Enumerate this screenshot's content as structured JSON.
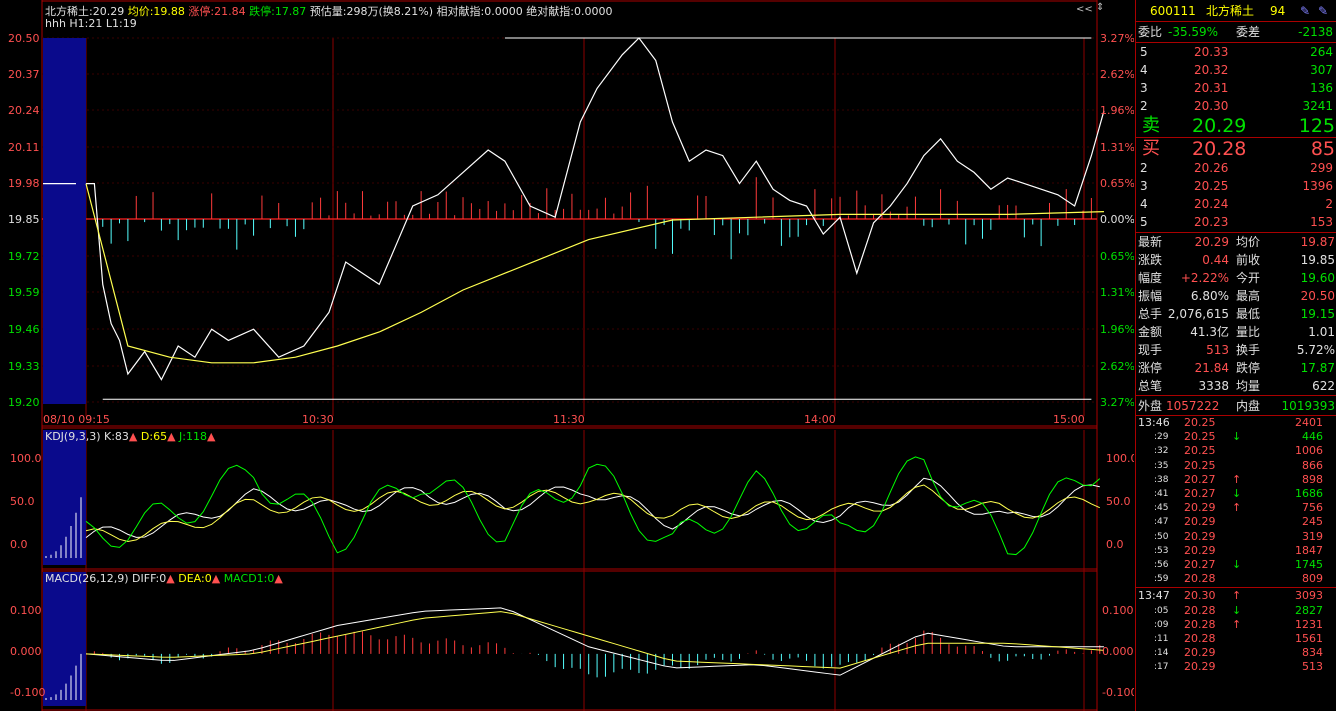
{
  "header": {
    "name": "北方稀土:20.29",
    "avg": "均价:19.88",
    "limit_up": "涨停:21.84",
    "limit_down": "跌停:17.87",
    "forecast": "预估量:298万(换8.21%)",
    "rel_contrib": "相对献指:0.0000",
    "abs_contrib": "绝对献指:0.0000",
    "line2": "hhh  H1:21  L1:19",
    "btn_close": "<<",
    "btn_pin": "⇕"
  },
  "price_axis": {
    "left": [
      "20.50",
      "20.37",
      "20.24",
      "20.11",
      "19.98",
      "19.85",
      "19.72",
      "19.59",
      "19.46",
      "19.33",
      "19.20"
    ],
    "right": [
      "3.27%",
      "2.62%",
      "1.96%",
      "1.31%",
      "0.65%",
      "0.00%",
      "0.65%",
      "1.31%",
      "1.96%",
      "2.62%",
      "3.27%"
    ]
  },
  "time_axis": [
    "08/10 09:15",
    "10:30",
    "11:30",
    "14:00",
    "15:00"
  ],
  "kdj": {
    "label": "KDJ(9,3,3)",
    "k": "K:83",
    "d": "D:65",
    "j": "J:118",
    "axis": [
      "100.0",
      "50.0",
      "0.0"
    ]
  },
  "macd": {
    "label": "MACD(26,12,9)",
    "diff": "DIFF:0",
    "dea": "DEA:0",
    "macd1": "MACD1:0",
    "axis": [
      "0.100",
      "0.000",
      "-0.100"
    ]
  },
  "colors": {
    "up": "#ff3b3b",
    "down": "#54ffff",
    "price": "#ffffff",
    "avg": "#ffff50",
    "grid": "#8b0000",
    "kdj_j": "#00ff00"
  },
  "stock": {
    "code": "600111",
    "name": "北方稀土",
    "num": "94"
  },
  "ratio": {
    "label1": "委比",
    "value1": "-35.59%",
    "label2": "委差",
    "value2": "-2138"
  },
  "asks": [
    {
      "lvl": "5",
      "price": "20.33",
      "vol": "264"
    },
    {
      "lvl": "4",
      "price": "20.32",
      "vol": "307"
    },
    {
      "lvl": "3",
      "price": "20.31",
      "vol": "136"
    },
    {
      "lvl": "2",
      "price": "20.30",
      "vol": "3241"
    }
  ],
  "sell1": {
    "label": "卖",
    "price": "20.29",
    "vol": "125"
  },
  "buy1": {
    "label": "买",
    "price": "20.28",
    "vol": "85"
  },
  "bids": [
    {
      "lvl": "2",
      "price": "20.26",
      "vol": "299"
    },
    {
      "lvl": "3",
      "price": "20.25",
      "vol": "1396"
    },
    {
      "lvl": "4",
      "price": "20.24",
      "vol": "2"
    },
    {
      "lvl": "5",
      "price": "20.23",
      "vol": "153"
    }
  ],
  "stats": [
    {
      "l1": "最新",
      "v1": "20.29",
      "c1": "red",
      "l2": "均价",
      "v2": "19.87",
      "c2": "red"
    },
    {
      "l1": "涨跌",
      "v1": "0.44",
      "c1": "red",
      "l2": "前收",
      "v2": "19.85",
      "c2": "white"
    },
    {
      "l1": "幅度",
      "v1": "+2.22%",
      "c1": "red",
      "l2": "今开",
      "v2": "19.60",
      "c2": "green"
    },
    {
      "l1": "振幅",
      "v1": "6.80%",
      "c1": "white",
      "l2": "最高",
      "v2": "20.50",
      "c2": "red"
    },
    {
      "l1": "总手",
      "v1": "2,076,615",
      "c1": "white",
      "l2": "最低",
      "v2": "19.15",
      "c2": "green"
    },
    {
      "l1": "金额",
      "v1": "41.3亿",
      "c1": "white",
      "l2": "量比",
      "v2": "1.01",
      "c2": "white"
    },
    {
      "l1": "现手",
      "v1": "513",
      "c1": "red",
      "l2": "换手",
      "v2": "5.72%",
      "c2": "white"
    },
    {
      "l1": "涨停",
      "v1": "21.84",
      "c1": "red",
      "l2": "跌停",
      "v2": "17.87",
      "c2": "green"
    },
    {
      "l1": "总笔",
      "v1": "3338",
      "c1": "white",
      "l2": "均量",
      "v2": "622",
      "c2": "white"
    }
  ],
  "outer_inner": {
    "l1": "外盘",
    "v1": "1057222",
    "l2": "内盘",
    "v2": "1019393"
  },
  "ticks": [
    {
      "t": "13:46",
      "p": "20.25",
      "a": "",
      "v": "2401",
      "c": "red"
    },
    {
      "t": ":29",
      "p": "20.25",
      "a": "↓",
      "v": "446",
      "c": "green"
    },
    {
      "t": ":32",
      "p": "20.25",
      "a": "",
      "v": "1006",
      "c": "red"
    },
    {
      "t": ":35",
      "p": "20.25",
      "a": "",
      "v": "866",
      "c": "red"
    },
    {
      "t": ":38",
      "p": "20.27",
      "a": "↑",
      "v": "898",
      "c": "red"
    },
    {
      "t": ":41",
      "p": "20.27",
      "a": "↓",
      "v": "1686",
      "c": "green"
    },
    {
      "t": ":45",
      "p": "20.29",
      "a": "↑",
      "v": "756",
      "c": "red"
    },
    {
      "t": ":47",
      "p": "20.29",
      "a": "",
      "v": "245",
      "c": "red"
    },
    {
      "t": ":50",
      "p": "20.29",
      "a": "",
      "v": "319",
      "c": "red"
    },
    {
      "t": ":53",
      "p": "20.29",
      "a": "",
      "v": "1847",
      "c": "red"
    },
    {
      "t": ":56",
      "p": "20.27",
      "a": "↓",
      "v": "1745",
      "c": "green"
    },
    {
      "t": ":59",
      "p": "20.28",
      "a": "",
      "v": "809",
      "c": "red"
    },
    {
      "t": "13:47",
      "p": "20.30",
      "a": "↑",
      "v": "3093",
      "c": "red"
    },
    {
      "t": ":05",
      "p": "20.28",
      "a": "↓",
      "v": "2827",
      "c": "green"
    },
    {
      "t": ":09",
      "p": "20.28",
      "a": "↑",
      "v": "1231",
      "c": "red"
    },
    {
      "t": ":11",
      "p": "20.28",
      "a": "",
      "v": "1561",
      "c": "red"
    },
    {
      "t": ":14",
      "p": "20.29",
      "a": "",
      "v": "834",
      "c": "red"
    },
    {
      "t": ":17",
      "p": "20.29",
      "a": "",
      "v": "513",
      "c": "red"
    }
  ],
  "chart_data": [
    {
      "type": "line",
      "title": "",
      "x_unit": "minute",
      "prev_close": 19.85,
      "ylim": [
        19.2,
        20.5
      ],
      "series": [
        {
          "name": "",
          "x": [
            0,
            2,
            4,
            6,
            8,
            10,
            14,
            18,
            22,
            26,
            30,
            34,
            40,
            46,
            52,
            58,
            62,
            66,
            70,
            74,
            78,
            84,
            90,
            96,
            100,
            106,
            112,
            118,
            122,
            128,
            132,
            136,
            140,
            144,
            148,
            152,
            156,
            160,
            164,
            168,
            172,
            176,
            180,
            184,
            188,
            192,
            196,
            200,
            204,
            208,
            212,
            216,
            220,
            224,
            228,
            232,
            236,
            240,
            243
          ],
          "values": [
            19.98,
            19.98,
            19.62,
            19.48,
            19.42,
            19.3,
            19.38,
            19.28,
            19.4,
            19.36,
            19.46,
            19.42,
            19.46,
            19.36,
            19.4,
            19.52,
            19.7,
            19.66,
            19.62,
            19.76,
            19.9,
            19.94,
            20.02,
            20.1,
            20.06,
            19.9,
            19.86,
            20.2,
            20.32,
            20.44,
            20.5,
            20.42,
            20.2,
            20.06,
            20.1,
            20.08,
            19.98,
            20.06,
            19.96,
            19.92,
            19.9,
            19.8,
            19.86,
            19.66,
            19.84,
            19.9,
            19.98,
            20.08,
            20.14,
            20.06,
            20.02,
            19.96,
            20.0,
            19.98,
            19.96,
            19.94,
            19.9,
            20.08,
            20.24
          ]
        },
        {
          "name": "",
          "x": [
            0,
            10,
            20,
            30,
            40,
            50,
            60,
            70,
            80,
            90,
            100,
            110,
            120,
            140,
            160,
            180,
            200,
            220,
            243
          ],
          "values": [
            19.98,
            19.4,
            19.36,
            19.34,
            19.34,
            19.36,
            19.4,
            19.45,
            19.52,
            19.6,
            19.66,
            19.72,
            19.78,
            19.85,
            19.86,
            19.87,
            19.87,
            19.87,
            19.88
          ]
        }
      ]
    },
    {
      "type": "line",
      "title": "KDJ(9,3,3)",
      "ylim": [
        -5,
        125
      ],
      "series": [
        {
          "name": "K",
          "x": [
            0,
            20,
            40,
            60,
            80,
            100,
            120,
            140,
            160,
            180,
            200,
            220,
            243
          ],
          "values": [
            20,
            35,
            70,
            55,
            75,
            60,
            80,
            40,
            60,
            45,
            85,
            40,
            83
          ]
        },
        {
          "name": "D",
          "x": [
            0,
            20,
            40,
            60,
            80,
            100,
            120,
            140,
            160,
            180,
            200,
            220,
            243
          ],
          "values": [
            20,
            30,
            60,
            60,
            70,
            65,
            72,
            50,
            55,
            50,
            75,
            50,
            65
          ]
        },
        {
          "name": "J",
          "x": [
            0,
            20,
            40,
            60,
            80,
            100,
            120,
            140,
            160,
            180,
            200,
            220,
            243
          ],
          "values": [
            20,
            45,
            100,
            20,
            95,
            30,
            105,
            10,
            80,
            20,
            110,
            10,
            118
          ]
        }
      ]
    },
    {
      "type": "line",
      "title": "MACD(26,12,9)",
      "ylim": [
        -0.13,
        0.18
      ],
      "series": [
        {
          "name": "DIFF",
          "x": [
            0,
            20,
            40,
            60,
            80,
            100,
            120,
            140,
            160,
            180,
            200,
            220,
            243
          ],
          "values": [
            0,
            -0.02,
            0.01,
            0.08,
            0.12,
            0.13,
            0.02,
            -0.04,
            -0.03,
            -0.06,
            0.06,
            0.02,
            0.02
          ]
        },
        {
          "name": "DEA",
          "x": [
            0,
            20,
            40,
            60,
            80,
            100,
            120,
            140,
            160,
            180,
            200,
            220,
            243
          ],
          "values": [
            0,
            -0.01,
            0.0,
            0.05,
            0.1,
            0.12,
            0.05,
            -0.02,
            -0.03,
            -0.04,
            0.03,
            0.03,
            0.01
          ]
        }
      ]
    }
  ]
}
